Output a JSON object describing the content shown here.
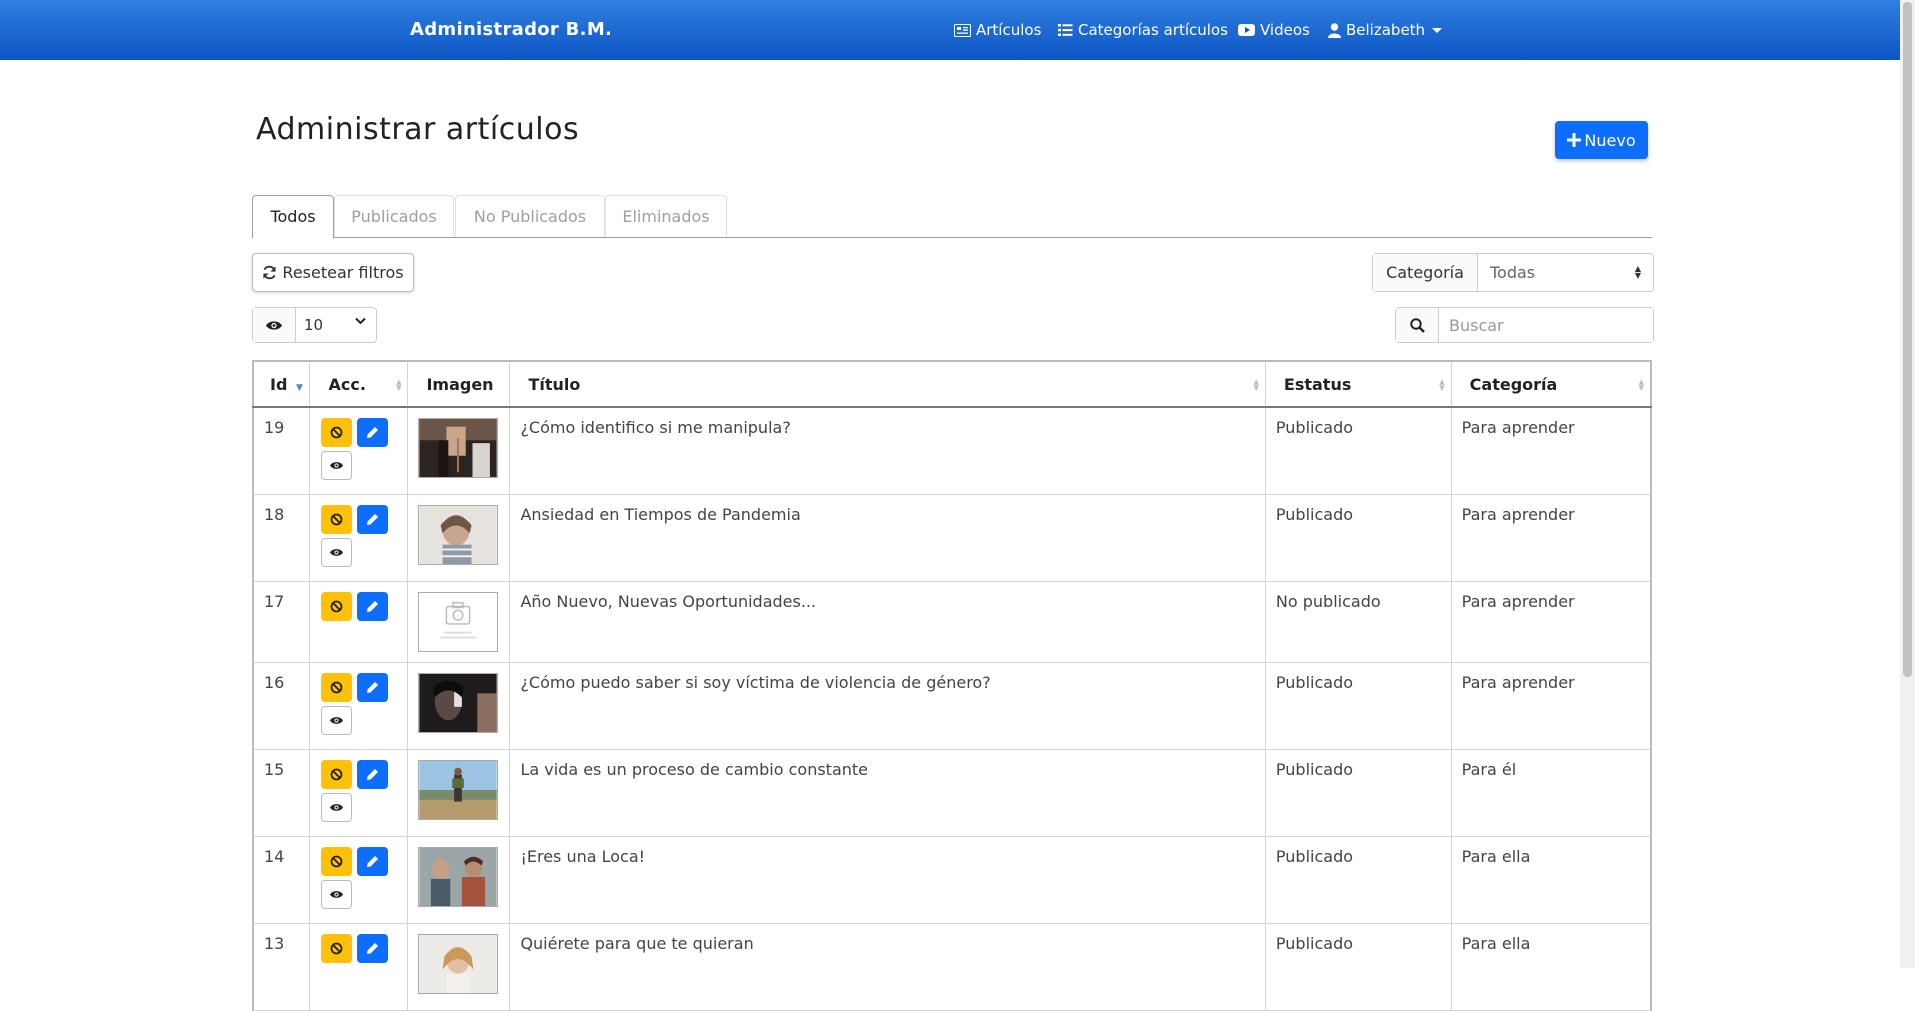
{
  "navbar": {
    "brand": "Administrador B.M.",
    "items": [
      {
        "label": "Artículos",
        "icon": "newspaper-icon"
      },
      {
        "label": "Categorías artículos",
        "icon": "list-icon"
      },
      {
        "label": "Videos",
        "icon": "youtube-icon"
      },
      {
        "label": "Belizabeth",
        "icon": "user-icon"
      }
    ]
  },
  "page": {
    "title": "Administrar artículos",
    "new_button": "Nuevo"
  },
  "tabs": [
    "Todos",
    "Publicados",
    "No Publicados",
    "Eliminados"
  ],
  "active_tab": "Todos",
  "filters": {
    "reset_label": "Resetear filtros",
    "category_label": "Categoría",
    "category_value": "Todas",
    "per_page": "10",
    "search_placeholder": "Buscar"
  },
  "table": {
    "columns": [
      "Id",
      "Acc.",
      "Imagen",
      "Título",
      "Estatus",
      "Categoría"
    ],
    "rows": [
      {
        "id": "19",
        "title": "¿Cómo identifico si me manipula?",
        "status": "Publicado",
        "category": "Para aprender"
      },
      {
        "id": "18",
        "title": "Ansiedad en Tiempos de Pandemia",
        "status": "Publicado",
        "category": "Para aprender"
      },
      {
        "id": "17",
        "title": "Año Nuevo, Nuevas Oportunidades...",
        "status": "No publicado",
        "category": "Para aprender"
      },
      {
        "id": "16",
        "title": "¿Cómo puedo saber si soy víctima de violencia de género?",
        "status": "Publicado",
        "category": "Para aprender"
      },
      {
        "id": "15",
        "title": "La vida es un proceso de cambio constante",
        "status": "Publicado",
        "category": "Para él"
      },
      {
        "id": "14",
        "title": "¡Eres una Loca!",
        "status": "Publicado",
        "category": "Para ella"
      },
      {
        "id": "13",
        "title": "Quiérete para que te quieran",
        "status": "Publicado",
        "category": "Para ella"
      }
    ]
  },
  "colors": {
    "nav_top": "#2f7fe0",
    "nav_bottom": "#0d55c4",
    "primary": "#0d6efd",
    "warning": "#ffc107",
    "published": "#28a745",
    "unpublished": "#dc3545"
  }
}
